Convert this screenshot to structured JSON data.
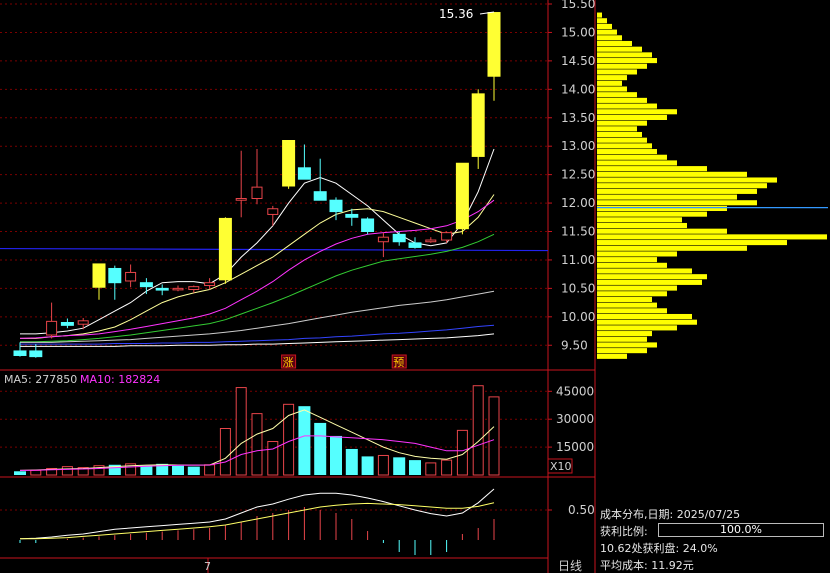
{
  "chart_data": [
    {
      "type": "candlestick",
      "x_ticks": [
        "7"
      ],
      "ylim": [
        9.1,
        15.5
      ],
      "y_ticks": [
        9.5,
        10.0,
        10.5,
        11.0,
        11.5,
        12.0,
        12.5,
        13.0,
        13.5,
        14.0,
        14.5,
        15.0,
        15.5
      ],
      "y_tick_labels": [
        "9.50",
        "10.00",
        "10.50",
        "11.00",
        "11.50",
        "12.00",
        "12.50",
        "13.00",
        "13.50",
        "14.00",
        "14.50",
        "15.00",
        "15.50"
      ],
      "high_label": "15.36",
      "reference_price": 11.2,
      "candles": [
        {
          "o": 9.4,
          "h": 9.55,
          "l": 9.3,
          "c": 9.32
        },
        {
          "o": 9.4,
          "h": 9.52,
          "l": 9.28,
          "c": 9.3
        },
        {
          "o": 9.68,
          "h": 10.25,
          "l": 9.62,
          "c": 9.92
        },
        {
          "o": 9.9,
          "h": 9.97,
          "l": 9.8,
          "c": 9.85
        },
        {
          "o": 9.87,
          "h": 9.98,
          "l": 9.78,
          "c": 9.93
        },
        {
          "o": 10.52,
          "h": 10.56,
          "l": 10.3,
          "c": 10.93
        },
        {
          "o": 10.85,
          "h": 10.9,
          "l": 10.3,
          "c": 10.6
        },
        {
          "o": 10.63,
          "h": 10.92,
          "l": 10.52,
          "c": 10.78
        },
        {
          "o": 10.6,
          "h": 10.68,
          "l": 10.4,
          "c": 10.53
        },
        {
          "o": 10.5,
          "h": 10.57,
          "l": 10.38,
          "c": 10.47
        },
        {
          "o": 10.48,
          "h": 10.55,
          "l": 10.45,
          "c": 10.5
        },
        {
          "o": 10.48,
          "h": 10.55,
          "l": 10.42,
          "c": 10.53
        },
        {
          "o": 10.55,
          "h": 10.68,
          "l": 10.48,
          "c": 10.6
        },
        {
          "o": 10.65,
          "h": 11.75,
          "l": 10.58,
          "c": 11.73
        },
        {
          "o": 12.05,
          "h": 12.92,
          "l": 11.75,
          "c": 12.08
        },
        {
          "o": 12.08,
          "h": 12.95,
          "l": 11.98,
          "c": 12.28
        },
        {
          "o": 11.8,
          "h": 11.95,
          "l": 11.6,
          "c": 11.9
        },
        {
          "o": 12.3,
          "h": 13.05,
          "l": 12.25,
          "c": 13.1
        },
        {
          "o": 12.62,
          "h": 13.03,
          "l": 12.52,
          "c": 12.42
        },
        {
          "o": 12.2,
          "h": 12.78,
          "l": 12.1,
          "c": 12.05
        },
        {
          "o": 12.05,
          "h": 12.1,
          "l": 11.7,
          "c": 11.85
        },
        {
          "o": 11.8,
          "h": 11.9,
          "l": 11.6,
          "c": 11.75
        },
        {
          "o": 11.72,
          "h": 11.75,
          "l": 11.45,
          "c": 11.5
        },
        {
          "o": 11.32,
          "h": 11.48,
          "l": 11.05,
          "c": 11.4
        },
        {
          "o": 11.45,
          "h": 11.5,
          "l": 11.25,
          "c": 11.32
        },
        {
          "o": 11.3,
          "h": 11.4,
          "l": 11.2,
          "c": 11.22
        },
        {
          "o": 11.32,
          "h": 11.4,
          "l": 11.3,
          "c": 11.35
        },
        {
          "o": 11.35,
          "h": 11.5,
          "l": 11.3,
          "c": 11.48
        },
        {
          "o": 11.55,
          "h": 12.7,
          "l": 11.45,
          "c": 12.7
        },
        {
          "o": 12.82,
          "h": 14.0,
          "l": 12.6,
          "c": 13.92
        },
        {
          "o": 14.23,
          "h": 15.36,
          "l": 13.8,
          "c": 15.35
        }
      ],
      "ma_series": [
        {
          "color": "#ffffff",
          "values": [
            9.7,
            9.7,
            9.72,
            9.75,
            9.8,
            9.95,
            10.1,
            10.25,
            10.45,
            10.6,
            10.62,
            10.62,
            10.58,
            10.75,
            11.05,
            11.3,
            11.6,
            12.0,
            12.35,
            12.45,
            12.35,
            12.15,
            11.95,
            11.7,
            11.45,
            11.3,
            11.25,
            11.3,
            11.65,
            12.2,
            12.95
          ]
        },
        {
          "color": "#ffff99",
          "values": [
            9.62,
            9.62,
            9.65,
            9.67,
            9.7,
            9.75,
            9.82,
            9.95,
            10.1,
            10.25,
            10.35,
            10.42,
            10.48,
            10.6,
            10.75,
            10.9,
            11.05,
            11.25,
            11.45,
            11.65,
            11.8,
            11.88,
            11.9,
            11.85,
            11.75,
            11.65,
            11.55,
            11.45,
            11.5,
            11.75,
            12.15
          ]
        },
        {
          "color": "#ff33ff",
          "values": [
            9.62,
            9.63,
            9.65,
            9.67,
            9.68,
            9.7,
            9.74,
            9.78,
            9.83,
            9.88,
            9.93,
            9.98,
            10.05,
            10.15,
            10.3,
            10.45,
            10.62,
            10.82,
            11.0,
            11.15,
            11.28,
            11.38,
            11.45,
            11.48,
            11.5,
            11.52,
            11.55,
            11.6,
            11.7,
            11.85,
            12.05
          ]
        },
        {
          "color": "#33cc33",
          "values": [
            9.56,
            9.56,
            9.57,
            9.58,
            9.6,
            9.62,
            9.65,
            9.68,
            9.72,
            9.76,
            9.8,
            9.84,
            9.88,
            9.95,
            10.05,
            10.15,
            10.25,
            10.36,
            10.48,
            10.6,
            10.72,
            10.82,
            10.9,
            10.98,
            11.02,
            11.06,
            11.1,
            11.15,
            11.22,
            11.32,
            11.45
          ]
        },
        {
          "color": "#cccccc",
          "values": [
            9.55,
            9.55,
            9.55,
            9.56,
            9.57,
            9.58,
            9.59,
            9.6,
            9.62,
            9.64,
            9.66,
            9.68,
            9.7,
            9.73,
            9.76,
            9.8,
            9.84,
            9.88,
            9.93,
            9.98,
            10.03,
            10.08,
            10.12,
            10.16,
            10.2,
            10.23,
            10.26,
            10.3,
            10.35,
            10.4,
            10.45
          ]
        },
        {
          "color": "#3344ff",
          "values": [
            9.52,
            9.52,
            9.52,
            9.52,
            9.52,
            9.52,
            9.53,
            9.53,
            9.53,
            9.54,
            9.54,
            9.55,
            9.55,
            9.56,
            9.57,
            9.58,
            9.59,
            9.6,
            9.62,
            9.63,
            9.65,
            9.66,
            9.68,
            9.7,
            9.71,
            9.73,
            9.75,
            9.77,
            9.8,
            9.83,
            9.85
          ]
        },
        {
          "color": "#ffffff",
          "values": [
            9.48,
            9.48,
            9.48,
            9.48,
            9.48,
            9.48,
            9.48,
            9.49,
            9.49,
            9.49,
            9.5,
            9.5,
            9.5,
            9.51,
            9.51,
            9.52,
            9.52,
            9.53,
            9.54,
            9.55,
            9.56,
            9.57,
            9.58,
            9.59,
            9.6,
            9.61,
            9.62,
            9.63,
            9.65,
            9.67,
            9.7
          ]
        }
      ],
      "markers": [
        {
          "index": 17,
          "label": "涨"
        },
        {
          "index": 24,
          "label": "预"
        }
      ]
    },
    {
      "type": "bar",
      "ylim": [
        0,
        50000
      ],
      "y_ticks": [
        15000,
        30000,
        45000
      ],
      "y_tick_labels": [
        "15000",
        "30000",
        "45000"
      ],
      "unit_label": "X10",
      "ma_legend": [
        {
          "label": "MA5: 277850",
          "color": "#ffffff"
        },
        {
          "label": "MA10: 182824",
          "color": "#ff33ff"
        }
      ],
      "values": [
        2000,
        2500,
        3500,
        4500,
        4000,
        5000,
        5500,
        6000,
        5000,
        6000,
        5000,
        4500,
        5500,
        25000,
        47000,
        33000,
        18000,
        38000,
        37000,
        28000,
        21000,
        14000,
        10000,
        10500,
        9500,
        8000,
        6500,
        8000,
        24000,
        48000,
        42000
      ],
      "up": [
        false,
        true,
        true,
        true,
        true,
        true,
        false,
        true,
        false,
        false,
        false,
        false,
        true,
        true,
        true,
        true,
        true,
        true,
        false,
        false,
        false,
        false,
        false,
        true,
        false,
        false,
        true,
        true,
        true,
        true,
        true
      ],
      "ma5": [
        2500,
        2700,
        3000,
        3300,
        3500,
        4000,
        4500,
        5000,
        5300,
        5500,
        5400,
        5300,
        5300,
        9000,
        17000,
        22000,
        25000,
        32000,
        35000,
        31000,
        27000,
        23000,
        19000,
        15000,
        12000,
        10000,
        9000,
        8500,
        11000,
        18000,
        26000
      ],
      "ma10": [
        2500,
        2600,
        2800,
        3000,
        3200,
        3500,
        3900,
        4300,
        4700,
        5000,
        5200,
        5300,
        5400,
        7000,
        11000,
        13000,
        14000,
        18000,
        21000,
        21000,
        20500,
        20000,
        19500,
        19000,
        18000,
        17000,
        15000,
        13000,
        13000,
        16000,
        19000
      ]
    },
    {
      "type": "macd",
      "y_ticks": [
        0.5
      ],
      "y_tick_labels": [
        "0.50"
      ],
      "zero_level": 0,
      "dif": [
        0.02,
        0.03,
        0.05,
        0.08,
        0.1,
        0.14,
        0.18,
        0.2,
        0.22,
        0.24,
        0.26,
        0.28,
        0.3,
        0.35,
        0.45,
        0.55,
        0.6,
        0.68,
        0.75,
        0.78,
        0.78,
        0.75,
        0.7,
        0.64,
        0.57,
        0.5,
        0.44,
        0.4,
        0.45,
        0.62,
        0.85
      ],
      "dea": [
        0.02,
        0.02,
        0.03,
        0.04,
        0.06,
        0.08,
        0.1,
        0.12,
        0.14,
        0.16,
        0.18,
        0.2,
        0.22,
        0.25,
        0.3,
        0.35,
        0.4,
        0.45,
        0.5,
        0.55,
        0.58,
        0.6,
        0.61,
        0.6,
        0.59,
        0.57,
        0.55,
        0.53,
        0.53,
        0.56,
        0.62
      ],
      "hist": [
        -0.05,
        -0.05,
        0.0,
        0.02,
        0.04,
        0.06,
        0.08,
        0.1,
        0.12,
        0.14,
        0.16,
        0.18,
        0.2,
        0.25,
        0.3,
        0.4,
        0.45,
        0.5,
        0.55,
        0.5,
        0.45,
        0.35,
        0.15,
        -0.05,
        -0.2,
        -0.25,
        -0.25,
        -0.2,
        0.1,
        0.2,
        0.35
      ],
      "period_label": "日线"
    }
  ],
  "cost_distribution": {
    "prices": [
      9.3,
      9.4,
      9.5,
      9.6,
      9.7,
      9.8,
      9.9,
      10.0,
      10.1,
      10.2,
      10.3,
      10.4,
      10.5,
      10.6,
      10.7,
      10.8,
      10.9,
      11.0,
      11.1,
      11.2,
      11.3,
      11.4,
      11.5,
      11.6,
      11.7,
      11.8,
      11.9,
      12.0,
      12.1,
      12.2,
      12.3,
      12.4,
      12.5,
      12.6,
      12.7,
      12.8,
      12.9,
      13.0,
      13.1,
      13.2,
      13.3,
      13.4,
      13.5,
      13.6,
      13.7,
      13.8,
      13.9,
      14.0,
      14.1,
      14.2,
      14.3,
      14.4,
      14.5,
      14.6,
      14.7,
      14.8,
      14.9,
      15.0,
      15.1,
      15.2,
      15.3
    ],
    "widths": [
      30,
      50,
      60,
      50,
      55,
      80,
      100,
      95,
      70,
      60,
      55,
      70,
      80,
      105,
      110,
      95,
      70,
      60,
      80,
      150,
      190,
      230,
      130,
      90,
      85,
      110,
      130,
      160,
      140,
      160,
      170,
      180,
      150,
      110,
      80,
      70,
      60,
      55,
      50,
      45,
      40,
      50,
      70,
      80,
      60,
      50,
      40,
      30,
      25,
      30,
      40,
      50,
      60,
      55,
      45,
      35,
      25,
      20,
      15,
      10,
      5
    ],
    "highlight_price": 11.92,
    "title": "成本分布,日期:",
    "date": "2025/07/25",
    "profit_ratio_label": "获利比例:",
    "profit_ratio_value": "100.0%",
    "profit_ratio_fraction": 1.0,
    "profit_at_price_line": "10.62处获利盘:",
    "profit_at_price_value": "24.0%",
    "avg_cost_label": "平均成本:",
    "avg_cost_value": "11.92元"
  },
  "colors": {
    "up": "#e8454a",
    "down": "#55ffff",
    "bull_fill": "#ffff33",
    "grid": "#7a0000",
    "axis": "#c8141e",
    "text": "#d0d0d0",
    "ref_line": "#2222ee"
  }
}
